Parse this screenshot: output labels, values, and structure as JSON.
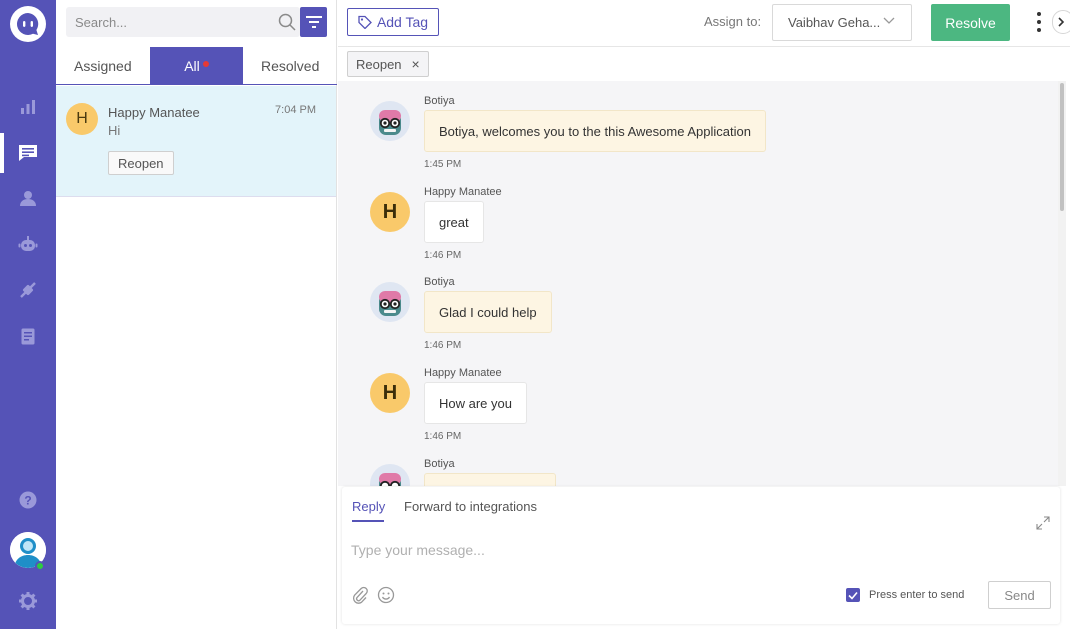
{
  "sidebar": {
    "nav": [
      {
        "icon": "bar-chart-icon"
      },
      {
        "icon": "chat-icon",
        "active": true
      },
      {
        "icon": "contacts-icon"
      },
      {
        "icon": "bot-icon"
      },
      {
        "icon": "integrations-icon"
      },
      {
        "icon": "reports-icon"
      }
    ],
    "bottom": [
      {
        "icon": "help-icon"
      },
      {
        "icon": "avatar"
      },
      {
        "icon": "settings-icon"
      }
    ]
  },
  "list": {
    "search_placeholder": "Search...",
    "tabs": [
      {
        "label": "Assigned"
      },
      {
        "label": "All",
        "active": true,
        "badge": true
      },
      {
        "label": "Resolved"
      }
    ],
    "conversations": [
      {
        "initial": "H",
        "name": "Happy Manatee",
        "preview": "Hi",
        "time": "7:04 PM",
        "action": "Reopen"
      }
    ]
  },
  "header": {
    "add_tag": "Add Tag",
    "assign_label": "Assign to:",
    "assignee": "Vaibhav Geha...",
    "resolve": "Resolve"
  },
  "tags": {
    "chip": "Reopen",
    "remove": "×"
  },
  "thread": {
    "messages": [
      {
        "sender": "Botiya",
        "type": "bot",
        "text": "Botiya, welcomes you to the this Awesome Application",
        "time": "1:45 PM"
      },
      {
        "sender": "Happy Manatee",
        "type": "human",
        "initial": "H",
        "text": "great",
        "time": "1:46 PM"
      },
      {
        "sender": "Botiya",
        "type": "bot",
        "text": "Glad I could help",
        "time": "1:46 PM"
      },
      {
        "sender": "Happy Manatee",
        "type": "human",
        "initial": "H",
        "text": "How are you",
        "time": "1:46 PM"
      },
      {
        "sender": "Botiya",
        "type": "bot",
        "text": "",
        "time": ""
      }
    ]
  },
  "composer": {
    "tabs": [
      {
        "label": "Reply",
        "active": true
      },
      {
        "label": "Forward to integrations"
      }
    ],
    "placeholder": "Type your message...",
    "enter_to_send_label": "Press enter to send",
    "enter_to_send_checked": true,
    "send": "Send"
  },
  "colors": {
    "brand": "#5553b7",
    "resolve": "#4cb781",
    "selected_row": "#e3f4fa",
    "bot_bubble": "#fdf5e3",
    "user_avatar": "#f9c96a"
  }
}
